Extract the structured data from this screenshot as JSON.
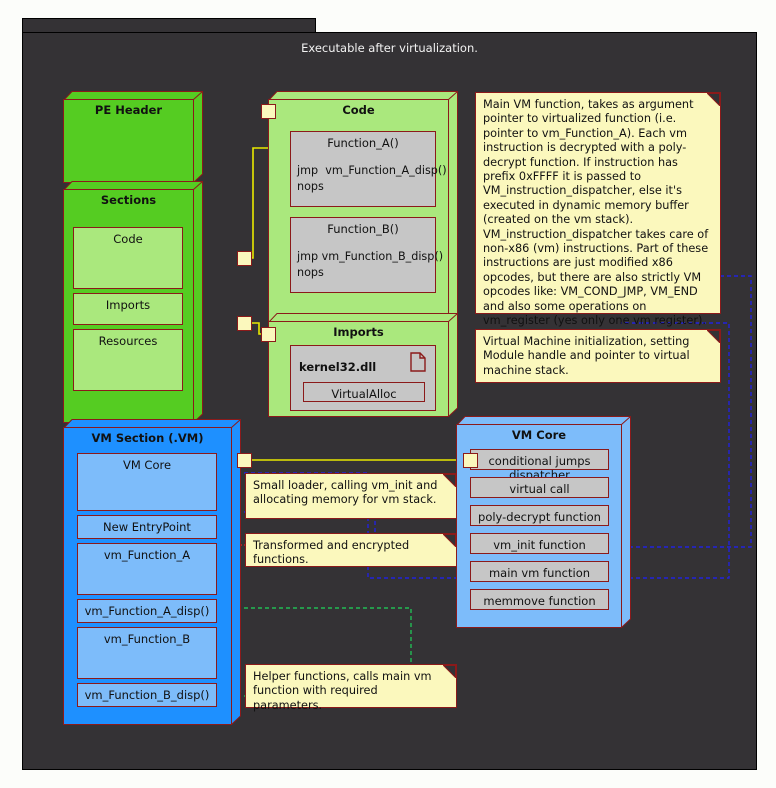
{
  "window": {
    "canvas_title": "Executable after virtualization.",
    "background": "#343235",
    "accent_border": "#8b1a1a"
  },
  "colors": {
    "green_dark": "#55cc22",
    "green_light": "#aae87d",
    "blue_mid": "#1e90ff",
    "blue_light": "#7dbcfa",
    "grey": "#c6c6c6",
    "note_yellow": "#fbf8bd",
    "border_red": "#8b1a1a",
    "dash_blue": "#2222dd",
    "dash_red": "#cc2222",
    "dash_green": "#22bb55",
    "connector_yellow": "#e8e800"
  },
  "pe_header": {
    "title": "PE Header"
  },
  "sections": {
    "title": "Sections",
    "items": [
      {
        "label": "Code"
      },
      {
        "label": "Imports"
      },
      {
        "label": "Resources"
      }
    ]
  },
  "code_package": {
    "title": "Code",
    "functions": [
      {
        "name": "Function_A()",
        "lines": [
          "jmp  vm_Function_A_disp()",
          "nops"
        ]
      },
      {
        "name": "Function_B()",
        "lines": [
          "jmp vm_Function_B_disp()",
          "nops"
        ]
      }
    ]
  },
  "imports_package": {
    "title": "Imports",
    "dll": "kernel32.dll",
    "dll_icon": "document-icon",
    "apis": [
      "VirtualAlloc"
    ]
  },
  "vm_section": {
    "title": "VM Section (.VM)",
    "items": [
      {
        "label": "VM Core",
        "tall": true
      },
      {
        "label": "New EntryPoint",
        "tall": false
      },
      {
        "label": "vm_Function_A",
        "tall": true
      },
      {
        "label": "vm_Function_A_disp()",
        "tall": false
      },
      {
        "label": "vm_Function_B",
        "tall": true
      },
      {
        "label": "vm_Function_B_disp()",
        "tall": false
      }
    ]
  },
  "vm_core": {
    "title": "VM Core",
    "items": [
      {
        "label": "conditional jumps dispatcher"
      },
      {
        "label": "virtual call"
      },
      {
        "label": "poly-decrypt function"
      },
      {
        "label": "vm_init function"
      },
      {
        "label": "main vm function"
      },
      {
        "label": "memmove function"
      }
    ]
  },
  "notes": {
    "main_vm_function": "Main VM function, takes as argument pointer to virtualized function (i.e. pointer to vm_Function_A). Each vm instruction is decrypted with a poly-decrypt function. If instruction has prefix 0xFFFF it is passed to VM_instruction_dispatcher, else it's executed in dynamic memory buffer (created on the vm stack). VM_instruction_dispatcher takes care of non-x86 (vm) instructions. Part of these instructions are just modified x86 opcodes, but there are also strictly VM opcodes like: VM_COND_JMP, VM_END and also some operations on vm_register (yes only one vm register).",
    "vm_init": "Virtual Machine initialization, setting Module handle and pointer to virtual machine stack.",
    "small_loader": "Small loader, calling vm_init and allocating memory for vm stack.",
    "transformed": "Transformed and encrypted functions.",
    "helper": "Helper functions, calls main vm function with required parameters."
  }
}
